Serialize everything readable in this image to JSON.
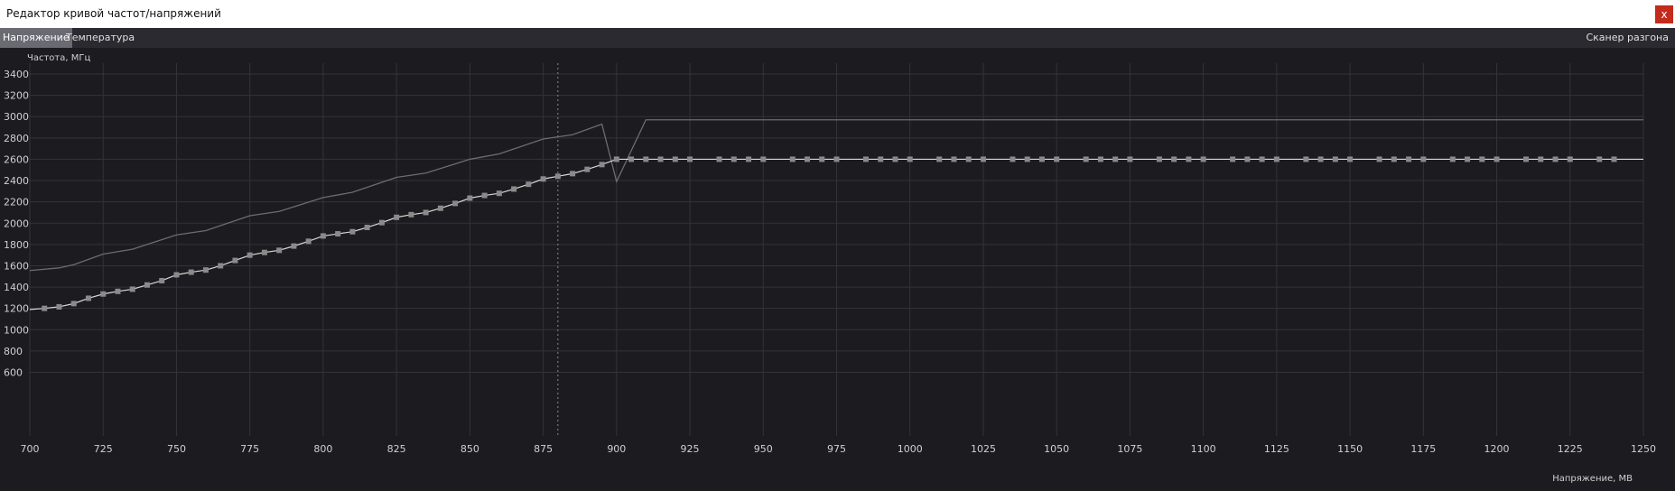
{
  "window": {
    "title": "Редактор кривой частот/напряжений",
    "close_label": "x"
  },
  "tabs": [
    {
      "label": "Напряжение",
      "active": true
    },
    {
      "label": "Температура",
      "active": false
    }
  ],
  "scanner_label": "Сканер разгона",
  "colors": {
    "background": "#1c1b20",
    "grid": "#33333a",
    "curve": "#d9d9d9",
    "default_curve": "#6c6c72",
    "marker": "#8a8a8a",
    "cursor_line": "#8a8a8a",
    "tab_active": "#6a6a72"
  },
  "chart_data": {
    "type": "line",
    "ylabel": "Частота, МГц",
    "xlabel": "Напряжение, МВ",
    "xlim": [
      700,
      1250
    ],
    "ylim": [
      500,
      3500
    ],
    "x_ticks": [
      700,
      725,
      750,
      775,
      800,
      825,
      850,
      875,
      900,
      925,
      950,
      975,
      1000,
      1025,
      1050,
      1075,
      1100,
      1125,
      1150,
      1175,
      1200,
      1225,
      1250
    ],
    "y_ticks": [
      600,
      800,
      1000,
      1200,
      1400,
      1600,
      1800,
      2000,
      2200,
      2400,
      2600,
      2800,
      3000,
      3200,
      3400
    ],
    "grid": true,
    "cursor_x": 880,
    "series": [
      {
        "role": "edited",
        "points": [
          [
            700,
            1190
          ],
          [
            705,
            1200
          ],
          [
            710,
            1215
          ],
          [
            715,
            1245
          ],
          [
            720,
            1295
          ],
          [
            725,
            1335
          ],
          [
            730,
            1360
          ],
          [
            735,
            1380
          ],
          [
            740,
            1420
          ],
          [
            745,
            1460
          ],
          [
            750,
            1515
          ],
          [
            755,
            1540
          ],
          [
            760,
            1560
          ],
          [
            765,
            1600
          ],
          [
            770,
            1650
          ],
          [
            775,
            1700
          ],
          [
            780,
            1725
          ],
          [
            785,
            1745
          ],
          [
            790,
            1785
          ],
          [
            795,
            1830
          ],
          [
            800,
            1880
          ],
          [
            805,
            1900
          ],
          [
            810,
            1920
          ],
          [
            815,
            1960
          ],
          [
            820,
            2005
          ],
          [
            825,
            2055
          ],
          [
            830,
            2080
          ],
          [
            835,
            2100
          ],
          [
            840,
            2140
          ],
          [
            845,
            2185
          ],
          [
            850,
            2235
          ],
          [
            855,
            2260
          ],
          [
            860,
            2280
          ],
          [
            865,
            2320
          ],
          [
            870,
            2365
          ],
          [
            875,
            2415
          ],
          [
            880,
            2440
          ],
          [
            885,
            2465
          ],
          [
            890,
            2505
          ],
          [
            895,
            2550
          ],
          [
            900,
            2600
          ],
          [
            905,
            2600
          ],
          [
            910,
            2600
          ],
          [
            915,
            2600
          ],
          [
            920,
            2600
          ],
          [
            925,
            2600
          ],
          [
            935,
            2600
          ],
          [
            940,
            2600
          ],
          [
            945,
            2600
          ],
          [
            950,
            2600
          ],
          [
            960,
            2600
          ],
          [
            965,
            2600
          ],
          [
            970,
            2600
          ],
          [
            975,
            2600
          ],
          [
            985,
            2600
          ],
          [
            990,
            2600
          ],
          [
            995,
            2600
          ],
          [
            1000,
            2600
          ],
          [
            1010,
            2600
          ],
          [
            1015,
            2600
          ],
          [
            1020,
            2600
          ],
          [
            1025,
            2600
          ],
          [
            1035,
            2600
          ],
          [
            1040,
            2600
          ],
          [
            1045,
            2600
          ],
          [
            1050,
            2600
          ],
          [
            1060,
            2600
          ],
          [
            1065,
            2600
          ],
          [
            1070,
            2600
          ],
          [
            1075,
            2600
          ],
          [
            1085,
            2600
          ],
          [
            1090,
            2600
          ],
          [
            1095,
            2600
          ],
          [
            1100,
            2600
          ],
          [
            1110,
            2600
          ],
          [
            1115,
            2600
          ],
          [
            1120,
            2600
          ],
          [
            1125,
            2600
          ],
          [
            1135,
            2600
          ],
          [
            1140,
            2600
          ],
          [
            1145,
            2600
          ],
          [
            1150,
            2600
          ],
          [
            1160,
            2600
          ],
          [
            1165,
            2600
          ],
          [
            1170,
            2600
          ],
          [
            1175,
            2600
          ],
          [
            1185,
            2600
          ],
          [
            1190,
            2600
          ],
          [
            1195,
            2600
          ],
          [
            1200,
            2600
          ],
          [
            1210,
            2600
          ],
          [
            1215,
            2600
          ],
          [
            1220,
            2600
          ],
          [
            1225,
            2600
          ],
          [
            1235,
            2600
          ],
          [
            1240,
            2600
          ],
          [
            1250,
            2600
          ]
        ]
      },
      {
        "role": "default",
        "points": [
          [
            700,
            1555
          ],
          [
            710,
            1580
          ],
          [
            715,
            1610
          ],
          [
            725,
            1710
          ],
          [
            735,
            1755
          ],
          [
            750,
            1890
          ],
          [
            760,
            1930
          ],
          [
            775,
            2070
          ],
          [
            785,
            2110
          ],
          [
            800,
            2240
          ],
          [
            810,
            2290
          ],
          [
            825,
            2430
          ],
          [
            835,
            2470
          ],
          [
            850,
            2600
          ],
          [
            860,
            2650
          ],
          [
            875,
            2790
          ],
          [
            885,
            2830
          ],
          [
            895,
            2930
          ],
          [
            900,
            2390
          ],
          [
            910,
            2970
          ],
          [
            1250,
            2970
          ]
        ]
      }
    ]
  }
}
